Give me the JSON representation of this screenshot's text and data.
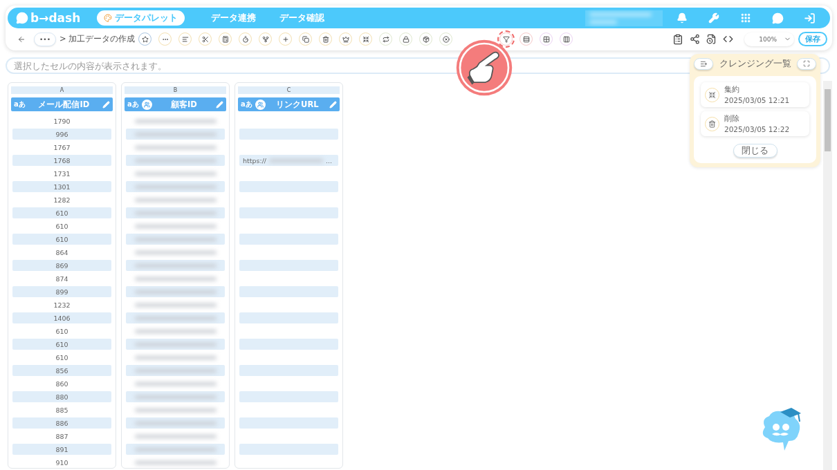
{
  "header": {
    "logo": "b→dash",
    "nav": [
      {
        "label": "データパレット",
        "selected": true
      },
      {
        "label": "データ連携",
        "selected": false
      },
      {
        "label": "データ確認",
        "selected": false
      }
    ]
  },
  "toolbar": {
    "more": "•••",
    "breadcrumb": "> 加工データの作成",
    "tools": [
      {
        "kind": "star",
        "color": "#a9c4e0",
        "selected": false
      },
      {
        "kind": "dots",
        "color": "#f3dfb0",
        "selected": false
      },
      {
        "kind": "text",
        "color": "#f3dfb0",
        "selected": false
      },
      {
        "kind": "tools",
        "color": "#f3dfb0",
        "selected": false
      },
      {
        "kind": "calc",
        "color": "#f3dfb0",
        "selected": false
      },
      {
        "kind": "timer",
        "color": "#f3dfb0",
        "selected": false
      },
      {
        "kind": "fork",
        "color": "#f3dfb0",
        "selected": false
      },
      {
        "kind": "plus",
        "color": "#f3dfb0",
        "selected": false
      },
      {
        "kind": "copy",
        "color": "#f3dfb0",
        "selected": false
      },
      {
        "kind": "trash",
        "color": "#f3dfb0",
        "selected": false
      },
      {
        "kind": "crown",
        "color": "#f3dfb0",
        "selected": false
      },
      {
        "kind": "shrink",
        "color": "#f3dfb0",
        "selected": false
      },
      {
        "kind": "repeat",
        "color": "#dfe8cf",
        "selected": false
      },
      {
        "kind": "lock",
        "color": "#dfe8cf",
        "selected": false
      },
      {
        "kind": "box",
        "color": "#dfe8cf",
        "selected": false
      },
      {
        "kind": "close",
        "color": "#dfe8cf",
        "selected": false
      },
      {
        "kind": "filter",
        "color": "#f6c9c9",
        "selected": true
      },
      {
        "kind": "split",
        "color": "#f6c9c9",
        "selected": false
      },
      {
        "kind": "grid",
        "color": "#ecd3f3",
        "selected": false
      },
      {
        "kind": "columns",
        "color": "#ecd3f3",
        "selected": false
      }
    ],
    "zoom": "100%",
    "save": "保存"
  },
  "cell_field": {
    "placeholder": "選択したセルの内容が表示されます。"
  },
  "columns": [
    {
      "letter": "A",
      "type_label": "aあ",
      "name": "メール配信ID",
      "linked": false,
      "redacted": false
    },
    {
      "letter": "B",
      "type_label": "aあ",
      "name": "顧客ID",
      "linked": true,
      "redacted": true
    },
    {
      "letter": "C",
      "type_label": "aあ",
      "name": "リンクURL",
      "linked": true,
      "redacted": false
    }
  ],
  "rows": [
    {
      "a": "1790"
    },
    {
      "a": "996"
    },
    {
      "a": "1767"
    },
    {
      "a": "1768",
      "c": "https://",
      "c_ellipsis": "..."
    },
    {
      "a": "1731"
    },
    {
      "a": "1301"
    },
    {
      "a": "1282"
    },
    {
      "a": "610"
    },
    {
      "a": "610"
    },
    {
      "a": "610"
    },
    {
      "a": "864"
    },
    {
      "a": "869"
    },
    {
      "a": "874"
    },
    {
      "a": "899"
    },
    {
      "a": "1232"
    },
    {
      "a": "1406"
    },
    {
      "a": "610"
    },
    {
      "a": "610"
    },
    {
      "a": "610"
    },
    {
      "a": "856"
    },
    {
      "a": "860"
    },
    {
      "a": "880"
    },
    {
      "a": "885"
    },
    {
      "a": "886"
    },
    {
      "a": "887"
    },
    {
      "a": "891"
    },
    {
      "a": "910"
    }
  ],
  "cleansing_panel": {
    "title": "クレンジング一覧",
    "items": [
      {
        "kind": "aggregate",
        "name": "集約",
        "time": "2025/03/05 12:21"
      },
      {
        "kind": "delete",
        "name": "削除",
        "time": "2025/03/05 12:22"
      }
    ],
    "close": "閉じる"
  }
}
